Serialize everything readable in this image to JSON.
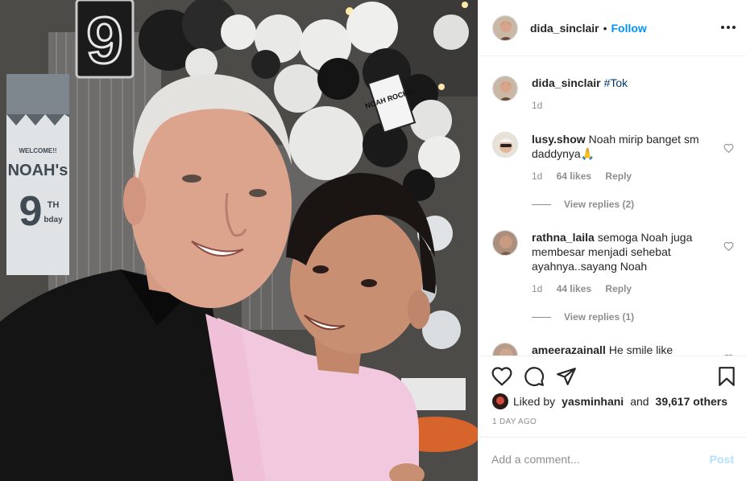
{
  "post": {
    "author": "dida_sinclair",
    "separator": "•",
    "follow_label": "Follow",
    "caption": {
      "username": "dida_sinclair",
      "hashtag": "#Tok",
      "age": "1d"
    }
  },
  "comments": [
    {
      "username": "lusy.show",
      "text": "Noah mirip banget sm daddynya🙏",
      "age": "1d",
      "likes": "64 likes",
      "reply_label": "Reply",
      "view_replies": "View replies (2)"
    },
    {
      "username": "rathna_laila",
      "text": "semoga Noah juga membesar menjadi sehebat ayahnya..sayang Noah",
      "age": "1d",
      "likes": "44 likes",
      "reply_label": "Reply",
      "view_replies": "View replies (1)"
    },
    {
      "username": "ameerazainall",
      "text": "He smile like"
    }
  ],
  "liked_by": {
    "prefix": "Liked by",
    "user": "yasminhani",
    "joiner": "and",
    "others": "39,617 others"
  },
  "timestamp": "1 DAY AGO",
  "add_comment": {
    "placeholder": "Add a comment...",
    "post_label": "Post"
  },
  "photo": {
    "banner_text": [
      "WELCOME!!",
      "NOAH's",
      "9",
      "TH",
      "bday"
    ],
    "balloon_sign": "9",
    "noah_rocks": "NOAH ROCKS!"
  },
  "colors": {
    "link_blue": "#0095f6",
    "hashtag": "#00376b",
    "muted": "#8e8e8e",
    "post_disabled": "#b2dffc",
    "border": "#efefef"
  },
  "icons": [
    "more-options-icon",
    "heart-icon",
    "comment-icon",
    "share-icon",
    "bookmark-icon"
  ]
}
